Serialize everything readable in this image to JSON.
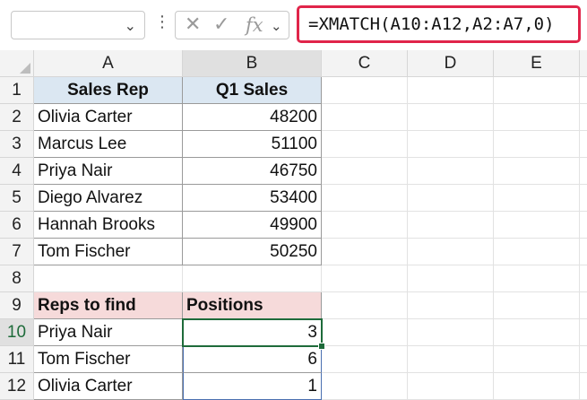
{
  "formula_bar": {
    "name_box_value": "",
    "cancel_icon": "x-icon",
    "enter_icon": "check-icon",
    "function_label": "fx",
    "formula": "=XMATCH(A10:A12,A2:A7,0)"
  },
  "columns": [
    "A",
    "B",
    "C",
    "D",
    "E"
  ],
  "rows": [
    "1",
    "2",
    "3",
    "4",
    "5",
    "6",
    "7",
    "8",
    "9",
    "10",
    "11",
    "12"
  ],
  "table1": {
    "headers": [
      "Sales Rep",
      "Q1 Sales"
    ],
    "data": [
      [
        "Olivia Carter",
        "48200"
      ],
      [
        "Marcus Lee",
        "51100"
      ],
      [
        "Priya Nair",
        "46750"
      ],
      [
        "Diego Alvarez",
        "53400"
      ],
      [
        "Hannah Brooks",
        "49900"
      ],
      [
        "Tom Fischer",
        "50250"
      ]
    ]
  },
  "table2": {
    "headers": [
      "Reps to find",
      "Positions"
    ],
    "data": [
      [
        "Priya Nair",
        "3"
      ],
      [
        "Tom Fischer",
        "6"
      ],
      [
        "Olivia Carter",
        "1"
      ]
    ]
  },
  "colors": {
    "header_blue": "#dbe7f2",
    "header_pink": "#f6dada",
    "formula_highlight": "#e0254a",
    "selection_green": "#1e6b3a"
  }
}
